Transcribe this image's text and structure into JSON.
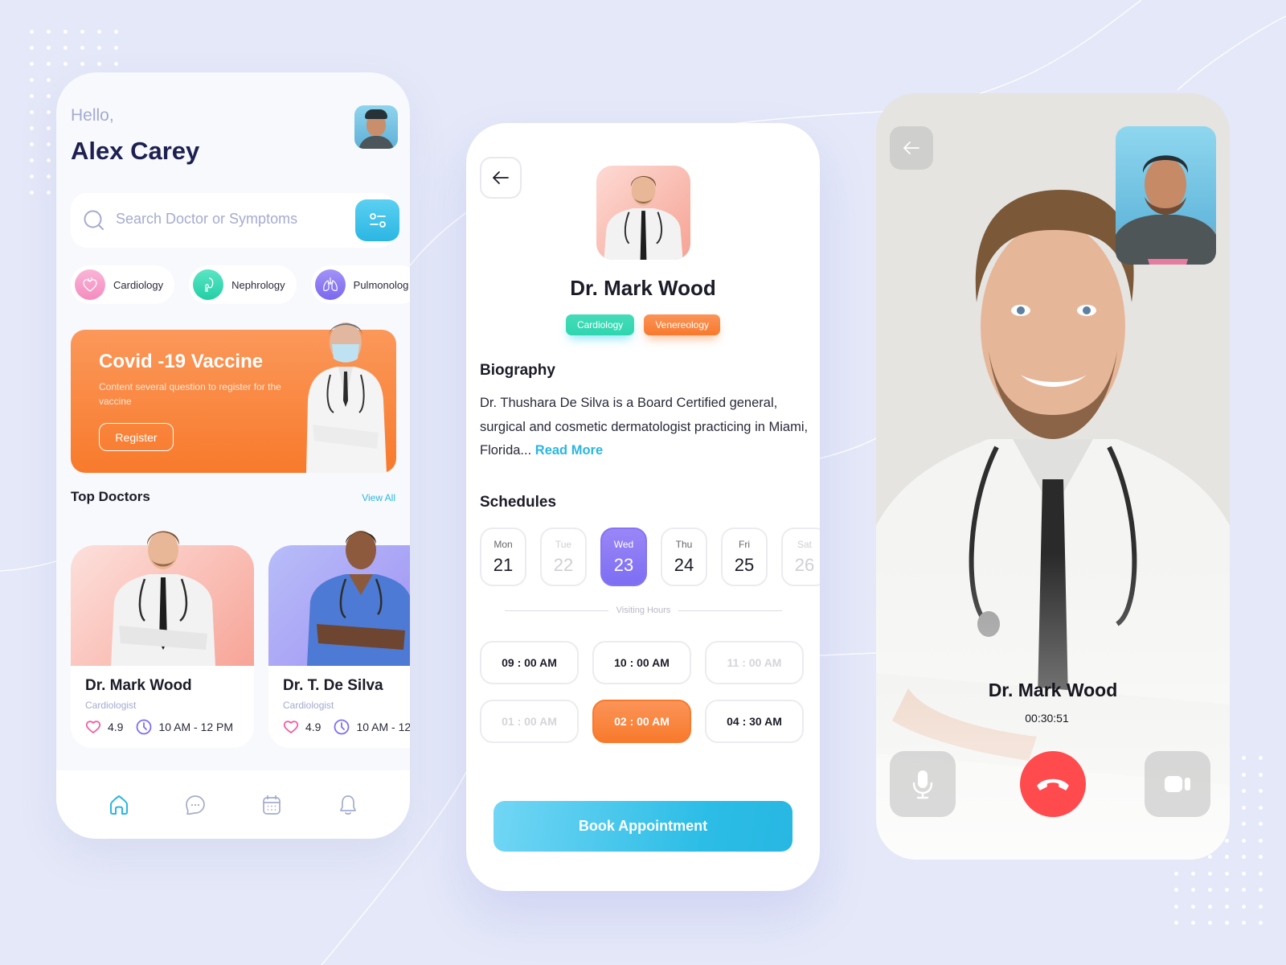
{
  "colors": {
    "background": "#e4e8f8",
    "accent_blue": "#2bb6e2",
    "accent_orange": "#f87a2c",
    "accent_purple": "#8574f4",
    "accent_green": "#2fd6b0",
    "end_call_red": "#ff4b4e"
  },
  "home": {
    "greeting": "Hello,",
    "user_name": "Alex Carey",
    "search": {
      "placeholder": "Search Doctor or Symptoms",
      "value": ""
    },
    "categories": [
      {
        "label": "Cardiology",
        "icon": "heart-organ-icon",
        "color": "#f79ac7"
      },
      {
        "label": "Nephrology",
        "icon": "kidney-icon",
        "color": "#2fd6b0"
      },
      {
        "label": "Pulmonolog",
        "icon": "lungs-icon",
        "color": "#8a7cf3"
      }
    ],
    "banner": {
      "title": "Covid -19 Vaccine",
      "subtitle": "Content several question to register for the vaccine",
      "button": "Register"
    },
    "top_doctors": {
      "title": "Top Doctors",
      "view_all": "View All",
      "doctors": [
        {
          "name": "Dr. Mark Wood",
          "specialty": "Cardiologist",
          "rating": "4.9",
          "hours": "10 AM - 12 PM"
        },
        {
          "name": "Dr. T. De Silva",
          "specialty": "Cardiologist",
          "rating": "4.9",
          "hours": "10 AM - 12"
        }
      ]
    },
    "nav": [
      {
        "name": "home",
        "icon": "home-icon",
        "active": true
      },
      {
        "name": "messages",
        "icon": "chat-icon",
        "active": false
      },
      {
        "name": "calendar",
        "icon": "calendar-icon",
        "active": false
      },
      {
        "name": "notifications",
        "icon": "bell-icon",
        "active": false
      }
    ]
  },
  "profile": {
    "name": "Dr. Mark Wood",
    "tags": [
      "Cardiology",
      "Venereology"
    ],
    "biography_title": "Biography",
    "biography": "Dr. Thushara De Silva is a Board Certified general, surgical and cosmetic dermatologist practicing in Miami, Florida...",
    "read_more": "Read More",
    "schedules_title": "Schedules",
    "days": [
      {
        "day": "Mon",
        "date": "21",
        "state": "available"
      },
      {
        "day": "Tue",
        "date": "22",
        "state": "disabled"
      },
      {
        "day": "Wed",
        "date": "23",
        "state": "selected"
      },
      {
        "day": "Thu",
        "date": "24",
        "state": "available"
      },
      {
        "day": "Fri",
        "date": "25",
        "state": "available"
      },
      {
        "day": "Sat",
        "date": "26",
        "state": "disabled"
      }
    ],
    "visiting_hours_label": "Visiting Hours",
    "times": [
      {
        "label": "09 : 00 AM",
        "state": "available"
      },
      {
        "label": "10 : 00 AM",
        "state": "available"
      },
      {
        "label": "11 : 00 AM",
        "state": "disabled"
      },
      {
        "label": "01 : 00 AM",
        "state": "disabled"
      },
      {
        "label": "02 : 00 AM",
        "state": "selected"
      },
      {
        "label": "04 : 30 AM",
        "state": "available"
      }
    ],
    "book_button": "Book Appointment"
  },
  "call": {
    "doctor_name": "Dr. Mark Wood",
    "timer": "00:30:51"
  }
}
